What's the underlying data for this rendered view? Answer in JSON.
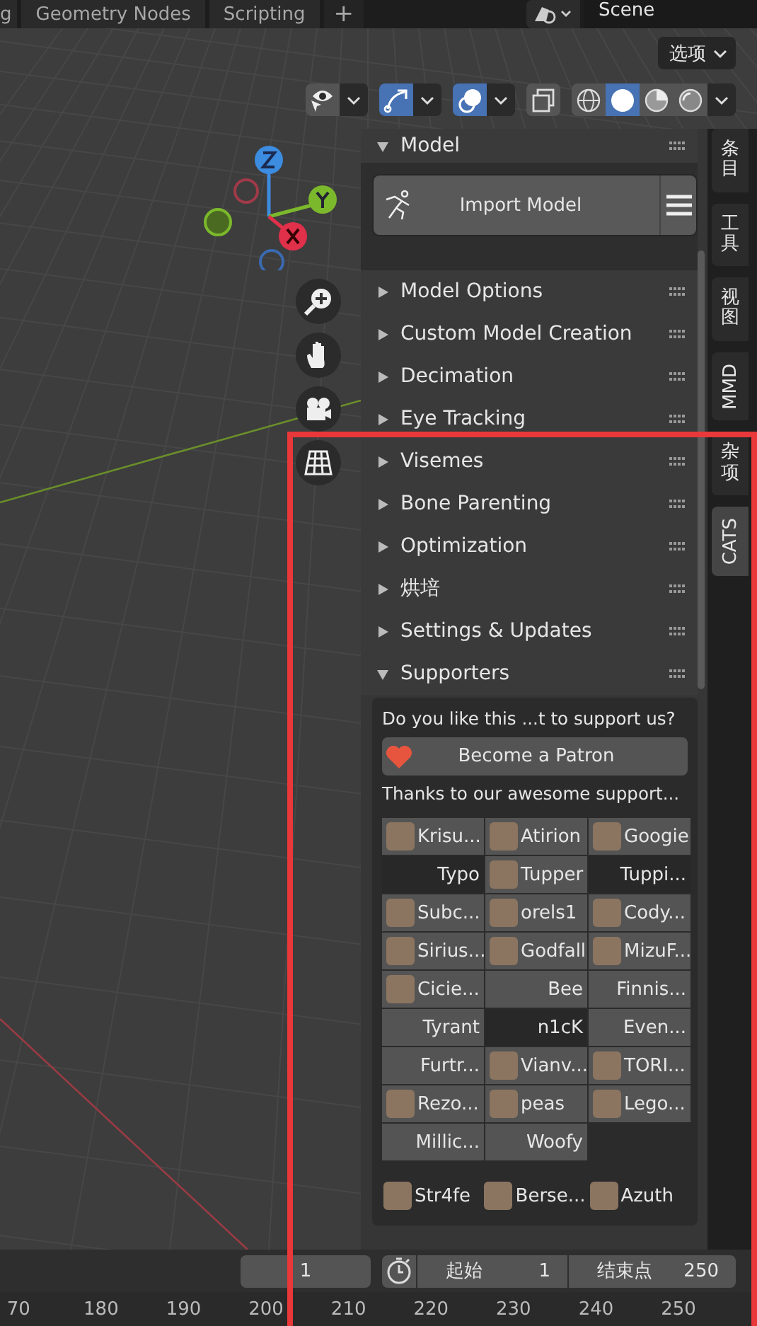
{
  "workspace_tabs": [
    {
      "label": "g",
      "selected": false
    },
    {
      "label": "Geometry Nodes",
      "selected": false
    },
    {
      "label": "Scripting",
      "selected": false
    }
  ],
  "add_tab": "+",
  "scene": {
    "name": "Scene"
  },
  "options_menu": "选项",
  "viewport_header": {
    "gizmos_on": true,
    "overlays_on": true,
    "xray_on": false,
    "shading_modes": [
      {
        "selected": false
      },
      {
        "selected": true
      },
      {
        "selected": false
      },
      {
        "selected": false
      }
    ]
  },
  "panels": [
    {
      "title": "Model",
      "kind": "model",
      "expanded": true
    },
    {
      "title": "Model Options",
      "kind": "generic",
      "expanded": false
    },
    {
      "title": "Custom Model Creation",
      "kind": "generic",
      "expanded": false
    },
    {
      "title": "Decimation",
      "kind": "generic",
      "expanded": false
    },
    {
      "title": "Eye Tracking",
      "kind": "generic",
      "expanded": false
    },
    {
      "title": "Visemes",
      "kind": "generic",
      "expanded": false
    },
    {
      "title": "Bone Parenting",
      "kind": "generic",
      "expanded": false
    },
    {
      "title": "Optimization",
      "kind": "generic",
      "expanded": false
    },
    {
      "title": "烘培",
      "kind": "generic",
      "expanded": false
    },
    {
      "title": "Settings & Updates",
      "kind": "generic",
      "expanded": false
    },
    {
      "title": "Supporters",
      "kind": "supporters",
      "expanded": true
    }
  ],
  "model_panel": {
    "import_button": "Import Model"
  },
  "supporters_panel": {
    "question": "Do you like this ...t to support us?",
    "patron_button": "Become a Patron",
    "thanks": "Thanks to our awesome support...",
    "supporters": [
      {
        "name": "Krisu...",
        "avatar": true,
        "kind": "raised"
      },
      {
        "name": "Atirion",
        "avatar": true,
        "kind": "raised"
      },
      {
        "name": "Googie",
        "avatar": true,
        "kind": "raised"
      },
      {
        "name": "Typo",
        "avatar": false,
        "kind": "sunken"
      },
      {
        "name": "Tupper",
        "avatar": true,
        "kind": "raised"
      },
      {
        "name": "Tuppi...",
        "avatar": false,
        "kind": "sunken"
      },
      {
        "name": "Subc...",
        "avatar": true,
        "kind": "raised"
      },
      {
        "name": "orels1",
        "avatar": true,
        "kind": "raised"
      },
      {
        "name": "Cody...",
        "avatar": true,
        "kind": "raised"
      },
      {
        "name": "Sirius...",
        "avatar": true,
        "kind": "raised"
      },
      {
        "name": "Godfall",
        "avatar": true,
        "kind": "raised"
      },
      {
        "name": "MizuF...",
        "avatar": true,
        "kind": "raised"
      },
      {
        "name": "Cicie...",
        "avatar": true,
        "kind": "raised"
      },
      {
        "name": "Bee",
        "avatar": false,
        "kind": "raised"
      },
      {
        "name": "Finnis...",
        "avatar": false,
        "kind": "raised"
      },
      {
        "name": "Tyrant",
        "avatar": false,
        "kind": "raised"
      },
      {
        "name": "n1cK",
        "avatar": false,
        "kind": "sunken"
      },
      {
        "name": "Even...",
        "avatar": false,
        "kind": "raised"
      },
      {
        "name": "Furtr...",
        "avatar": false,
        "kind": "raised"
      },
      {
        "name": "Vianv...",
        "avatar": true,
        "kind": "raised"
      },
      {
        "name": "TORI...",
        "avatar": true,
        "kind": "raised"
      },
      {
        "name": "Rezo...",
        "avatar": true,
        "kind": "raised"
      },
      {
        "name": "peas",
        "avatar": true,
        "kind": "raised"
      },
      {
        "name": "Lego...",
        "avatar": true,
        "kind": "raised"
      },
      {
        "name": "Millic...",
        "avatar": false,
        "kind": "raised"
      },
      {
        "name": "Woofy",
        "avatar": false,
        "kind": "raised"
      }
    ],
    "more_supporters": [
      {
        "name": "Str4fe",
        "avatar": true
      },
      {
        "name": "Berse...",
        "avatar": true
      },
      {
        "name": "Azuth",
        "avatar": true
      }
    ]
  },
  "sidebar_tabs": [
    {
      "label": "条目",
      "kind": "cjk",
      "selected": false
    },
    {
      "label": "工具",
      "kind": "cjk",
      "selected": false
    },
    {
      "label": "视图",
      "kind": "cjk",
      "selected": false
    },
    {
      "label": "MMD",
      "kind": "latin",
      "selected": false
    },
    {
      "label": "杂项",
      "kind": "cjk",
      "selected": false
    },
    {
      "label": "CATS",
      "kind": "latin",
      "selected": true
    }
  ],
  "timeline": {
    "current_frame": "1",
    "start_label": "起始",
    "start_frame": "1",
    "end_label": "结束点",
    "end_frame": "250"
  },
  "ruler": [
    "70",
    "180",
    "190",
    "200",
    "210",
    "220",
    "230",
    "240",
    "250"
  ]
}
